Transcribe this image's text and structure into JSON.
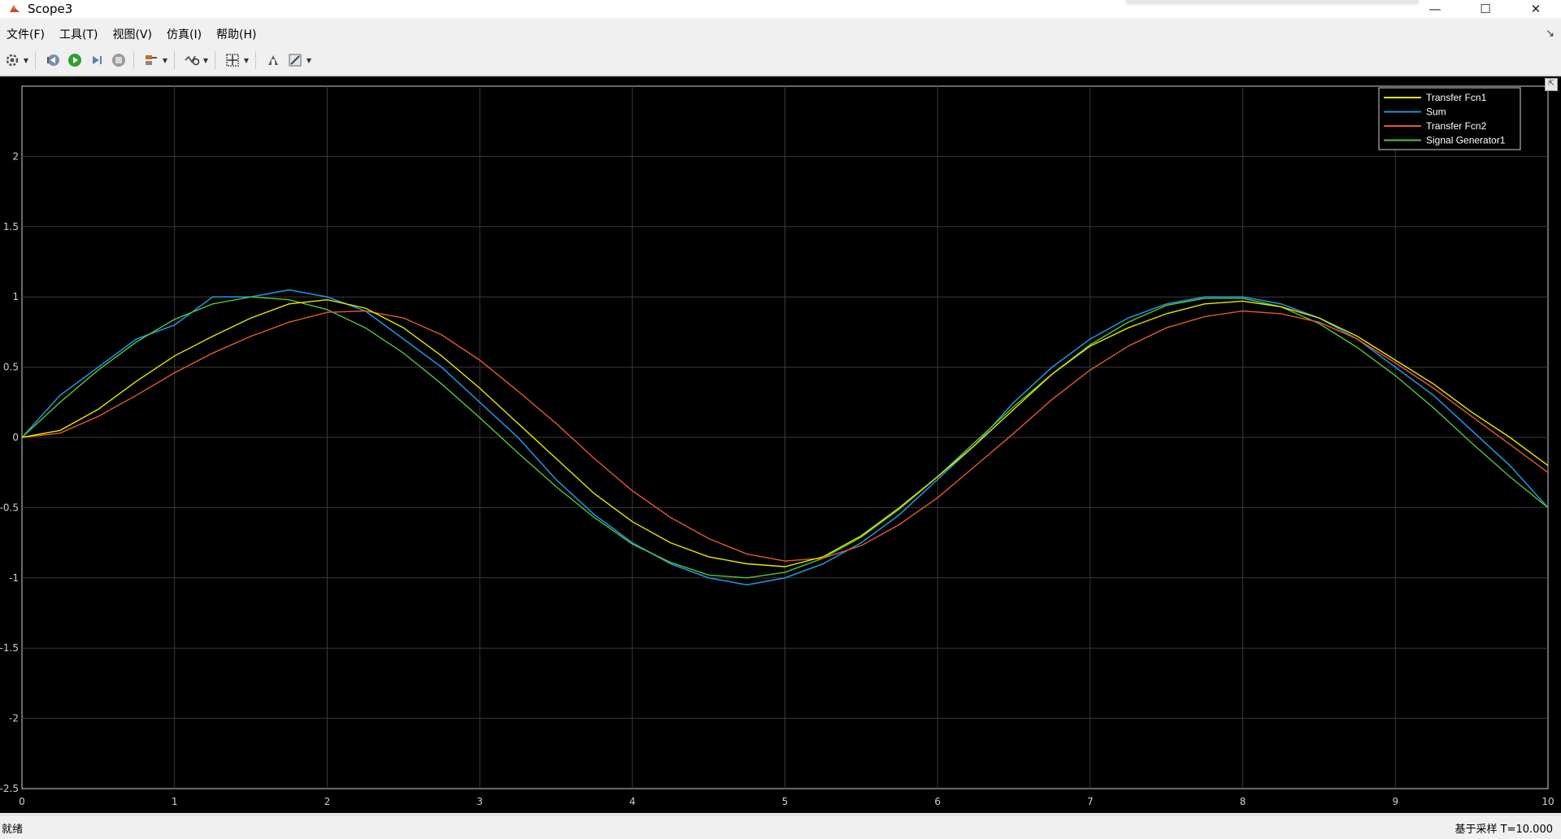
{
  "window": {
    "title": "Scope3",
    "minimize": "—",
    "maximize": "☐",
    "close": "✕"
  },
  "menu": {
    "items": [
      {
        "label": "文件(F)"
      },
      {
        "label": "工具(T)"
      },
      {
        "label": "视图(V)"
      },
      {
        "label": "仿真(I)"
      },
      {
        "label": "帮助(H)"
      }
    ],
    "dock_glyph": "↘"
  },
  "toolbar": {
    "icons": [
      "settings-icon",
      "step-back-icon",
      "run-icon",
      "step-forward-icon",
      "stop-icon",
      "highlight-icon",
      "zoom-icon",
      "fit-to-view-icon",
      "signal-select-icon",
      "edit-icon"
    ]
  },
  "status": {
    "left": "就绪",
    "right": "基于采样  T=10.000"
  },
  "colors": {
    "background": "#000000",
    "grid": "#3a3a3a",
    "axis": "#cfcfcf",
    "transfer_fcn1": "#e6e600",
    "sum": "#1e90d6",
    "transfer_fcn2": "#e05a2a",
    "signal_generator1": "#55c43a"
  },
  "chart_data": {
    "type": "line",
    "title": "",
    "xlabel": "",
    "ylabel": "",
    "xlim": [
      0,
      10
    ],
    "ylim": [
      -2.5,
      2.5
    ],
    "grid": true,
    "legend_position": "top-right",
    "x_ticks": [
      0,
      1,
      2,
      3,
      4,
      5,
      6,
      7,
      8,
      9,
      10
    ],
    "y_ticks": [
      2,
      1.5,
      1,
      0.5,
      0,
      -0.5,
      -1,
      -1.5,
      -2,
      -2.5
    ],
    "x_tick_labels": [
      "0",
      "1",
      "2",
      "3",
      "4",
      "5",
      "6",
      "7",
      "8",
      "9",
      "10"
    ],
    "y_tick_labels": [
      "2",
      "1.5",
      "1",
      "0.5",
      "0",
      "-0.5",
      "-1",
      "-1.5",
      "-2",
      "-2.5"
    ],
    "series": [
      {
        "name": "Transfer Fcn1",
        "color": "#e6e600",
        "x": [
          0,
          0.25,
          0.5,
          0.75,
          1,
          1.25,
          1.5,
          1.75,
          2,
          2.25,
          2.5,
          2.75,
          3,
          3.25,
          3.5,
          3.75,
          4,
          4.25,
          4.5,
          4.75,
          5,
          5.25,
          5.5,
          5.75,
          6,
          6.25,
          6.5,
          6.75,
          7,
          7.25,
          7.5,
          7.75,
          8,
          8.25,
          8.5,
          8.75,
          9,
          9.25,
          9.5,
          9.75,
          10
        ],
        "values": [
          0,
          0.05,
          0.2,
          0.4,
          0.58,
          0.72,
          0.85,
          0.95,
          0.98,
          0.92,
          0.78,
          0.58,
          0.35,
          0.1,
          -0.15,
          -0.4,
          -0.6,
          -0.75,
          -0.85,
          -0.9,
          -0.92,
          -0.85,
          -0.7,
          -0.5,
          -0.28,
          -0.05,
          0.2,
          0.45,
          0.65,
          0.78,
          0.88,
          0.95,
          0.97,
          0.93,
          0.85,
          0.72,
          0.55,
          0.38,
          0.18,
          0,
          -0.2
        ]
      },
      {
        "name": "Sum",
        "color": "#1e90d6",
        "x": [
          0,
          0.25,
          0.5,
          0.75,
          1,
          1.25,
          1.5,
          1.75,
          2,
          2.25,
          2.5,
          2.75,
          3,
          3.25,
          3.5,
          3.75,
          4,
          4.25,
          4.5,
          4.75,
          5,
          5.25,
          5.5,
          5.75,
          6,
          6.25,
          6.5,
          6.75,
          7,
          7.25,
          7.5,
          7.75,
          8,
          8.25,
          8.5,
          8.75,
          9,
          9.25,
          9.5,
          9.75,
          10
        ],
        "values": [
          0,
          0.3,
          0.5,
          0.7,
          0.8,
          1.0,
          1.0,
          1.05,
          1.0,
          0.9,
          0.7,
          0.5,
          0.25,
          0.0,
          -0.3,
          -0.55,
          -0.75,
          -0.9,
          -1.0,
          -1.05,
          -1.0,
          -0.9,
          -0.75,
          -0.55,
          -0.3,
          -0.05,
          0.25,
          0.5,
          0.7,
          0.85,
          0.95,
          1.0,
          1.0,
          0.95,
          0.85,
          0.7,
          0.5,
          0.3,
          0.05,
          -0.2,
          -0.5
        ]
      },
      {
        "name": "Transfer Fcn2",
        "color": "#e05a2a",
        "x": [
          0,
          0.25,
          0.5,
          0.75,
          1,
          1.25,
          1.5,
          1.75,
          2,
          2.25,
          2.5,
          2.75,
          3,
          3.25,
          3.5,
          3.75,
          4,
          4.25,
          4.5,
          4.75,
          5,
          5.25,
          5.5,
          5.75,
          6,
          6.25,
          6.5,
          6.75,
          7,
          7.25,
          7.5,
          7.75,
          8,
          8.25,
          8.5,
          8.75,
          9,
          9.25,
          9.5,
          9.75,
          10
        ],
        "values": [
          0,
          0.03,
          0.15,
          0.3,
          0.46,
          0.6,
          0.72,
          0.82,
          0.89,
          0.9,
          0.85,
          0.73,
          0.55,
          0.33,
          0.1,
          -0.15,
          -0.38,
          -0.57,
          -0.72,
          -0.83,
          -0.88,
          -0.86,
          -0.77,
          -0.62,
          -0.43,
          -0.2,
          0.03,
          0.27,
          0.48,
          0.65,
          0.78,
          0.86,
          0.9,
          0.88,
          0.82,
          0.7,
          0.53,
          0.35,
          0.15,
          -0.05,
          -0.25
        ]
      },
      {
        "name": "Signal Generator1",
        "color": "#55c43a",
        "x": [
          0,
          0.25,
          0.5,
          0.75,
          1,
          1.25,
          1.5,
          1.75,
          2,
          2.25,
          2.5,
          2.75,
          3,
          3.25,
          3.5,
          3.75,
          4,
          4.25,
          4.5,
          4.75,
          5,
          5.25,
          5.5,
          5.75,
          6,
          6.25,
          6.5,
          6.75,
          7,
          7.25,
          7.5,
          7.75,
          8,
          8.25,
          8.5,
          8.75,
          9,
          9.25,
          9.5,
          9.75,
          10
        ],
        "values": [
          0,
          0.25,
          0.48,
          0.68,
          0.84,
          0.95,
          1.0,
          0.98,
          0.91,
          0.78,
          0.6,
          0.38,
          0.14,
          -0.11,
          -0.35,
          -0.57,
          -0.76,
          -0.89,
          -0.98,
          -1.0,
          -0.96,
          -0.86,
          -0.71,
          -0.51,
          -0.28,
          -0.03,
          0.22,
          0.45,
          0.66,
          0.82,
          0.94,
          0.99,
          0.99,
          0.93,
          0.81,
          0.64,
          0.44,
          0.21,
          -0.04,
          -0.28,
          -0.5
        ]
      }
    ]
  }
}
